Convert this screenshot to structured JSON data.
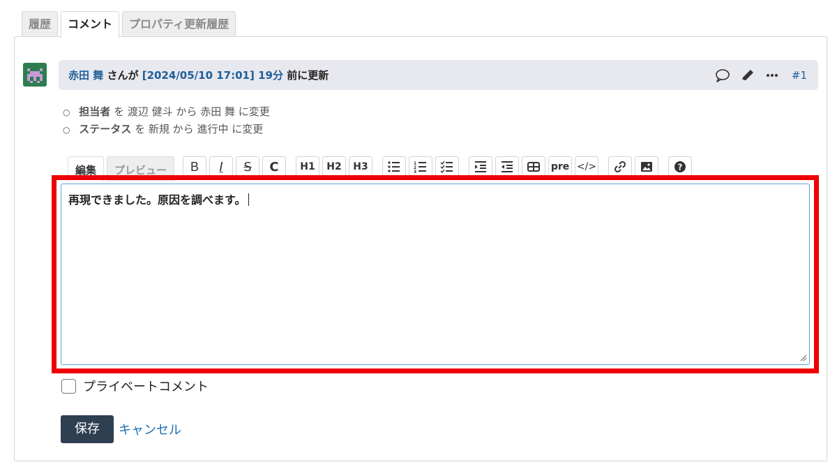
{
  "tabs": [
    {
      "label": "履歴"
    },
    {
      "label": "コメント"
    },
    {
      "label": "プロパティ更新履歴"
    }
  ],
  "journal": {
    "user": "赤田 舞",
    "san_ga": "さんが",
    "timestamp": "[2024/05/10 17:01]",
    "ago": "19分",
    "suffix": "前に更新",
    "number": "#1",
    "icons": [
      "comment-icon",
      "pencil-icon",
      "more-icon"
    ]
  },
  "details": [
    {
      "field": "担当者",
      "wo": "を",
      "from": "渡辺 健斗",
      "kara": "から",
      "to": "赤田 舞",
      "ni_henkou": "に変更"
    },
    {
      "field": "ステータス",
      "wo": "を",
      "from": "新規",
      "kara": "から",
      "to": "進行中",
      "ni_henkou": "に変更"
    }
  ],
  "editor": {
    "tab_edit": "編集",
    "tab_preview": "プレビュー",
    "buttons": {
      "bold": "B",
      "italic": "I",
      "strike": "S",
      "code": "C",
      "h1": "H1",
      "h2": "H2",
      "h3": "H3",
      "pre": "pre",
      "inline_code": "</>"
    },
    "content": "再現できました。原因を調べます。"
  },
  "private_note_label": "プライベートコメント",
  "private_note_checked": false,
  "save_label": "保存",
  "cancel_label": "キャンセル",
  "colors": {
    "highlight": "#ee0000",
    "link": "#1d5f97",
    "save_bg": "#2f3f52"
  }
}
